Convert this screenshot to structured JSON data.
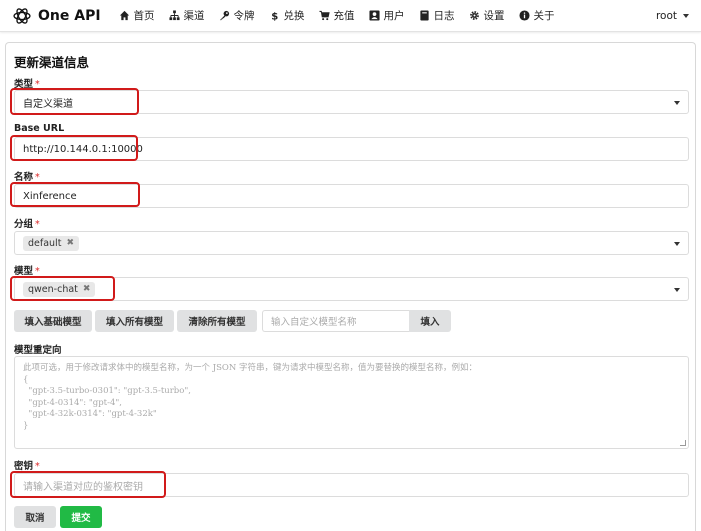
{
  "nav": {
    "brand": "One API",
    "items": [
      {
        "label": "首页",
        "icon": "home-icon"
      },
      {
        "label": "渠道",
        "icon": "sitemap-icon"
      },
      {
        "label": "令牌",
        "icon": "key-icon"
      },
      {
        "label": "兑换",
        "icon": "dollar-icon"
      },
      {
        "label": "充值",
        "icon": "cart-icon"
      },
      {
        "label": "用户",
        "icon": "user-icon"
      },
      {
        "label": "日志",
        "icon": "book-icon"
      },
      {
        "label": "设置",
        "icon": "gear-icon"
      },
      {
        "label": "关于",
        "icon": "info-icon"
      }
    ],
    "user": "root"
  },
  "form": {
    "title": "更新渠道信息",
    "type_label": "类型",
    "type_value": "自定义渠道",
    "base_url_label": "Base URL",
    "base_url_value": "http://10.144.0.1:10000",
    "name_label": "名称",
    "name_value": "Xinference",
    "group_label": "分组",
    "group_tag": "default",
    "model_label": "模型",
    "model_tag": "qwen-chat",
    "btn_fill_basic": "填入基础模型",
    "btn_fill_all": "填入所有模型",
    "btn_clear_all": "清除所有模型",
    "custom_model_placeholder": "输入自定义模型名称",
    "btn_fill": "填入",
    "mapping_label": "模型重定向",
    "mapping_placeholder": "此项可选，用于修改请求体中的模型名称，为一个 JSON 字符串，键为请求中模型名称，值为要替换的模型名称，例如：\n{\n  \"gpt-3.5-turbo-0301\": \"gpt-3.5-turbo\",\n  \"gpt-4-0314\": \"gpt-4\",\n  \"gpt-4-32k-0314\": \"gpt-4-32k\"\n}",
    "key_label": "密钥",
    "key_placeholder": "请输入渠道对应的鉴权密钥",
    "btn_cancel": "取消",
    "btn_submit": "提交"
  },
  "colors": {
    "highlight": "#d11a1a",
    "submit": "#21ba45",
    "required": "#db2828"
  }
}
